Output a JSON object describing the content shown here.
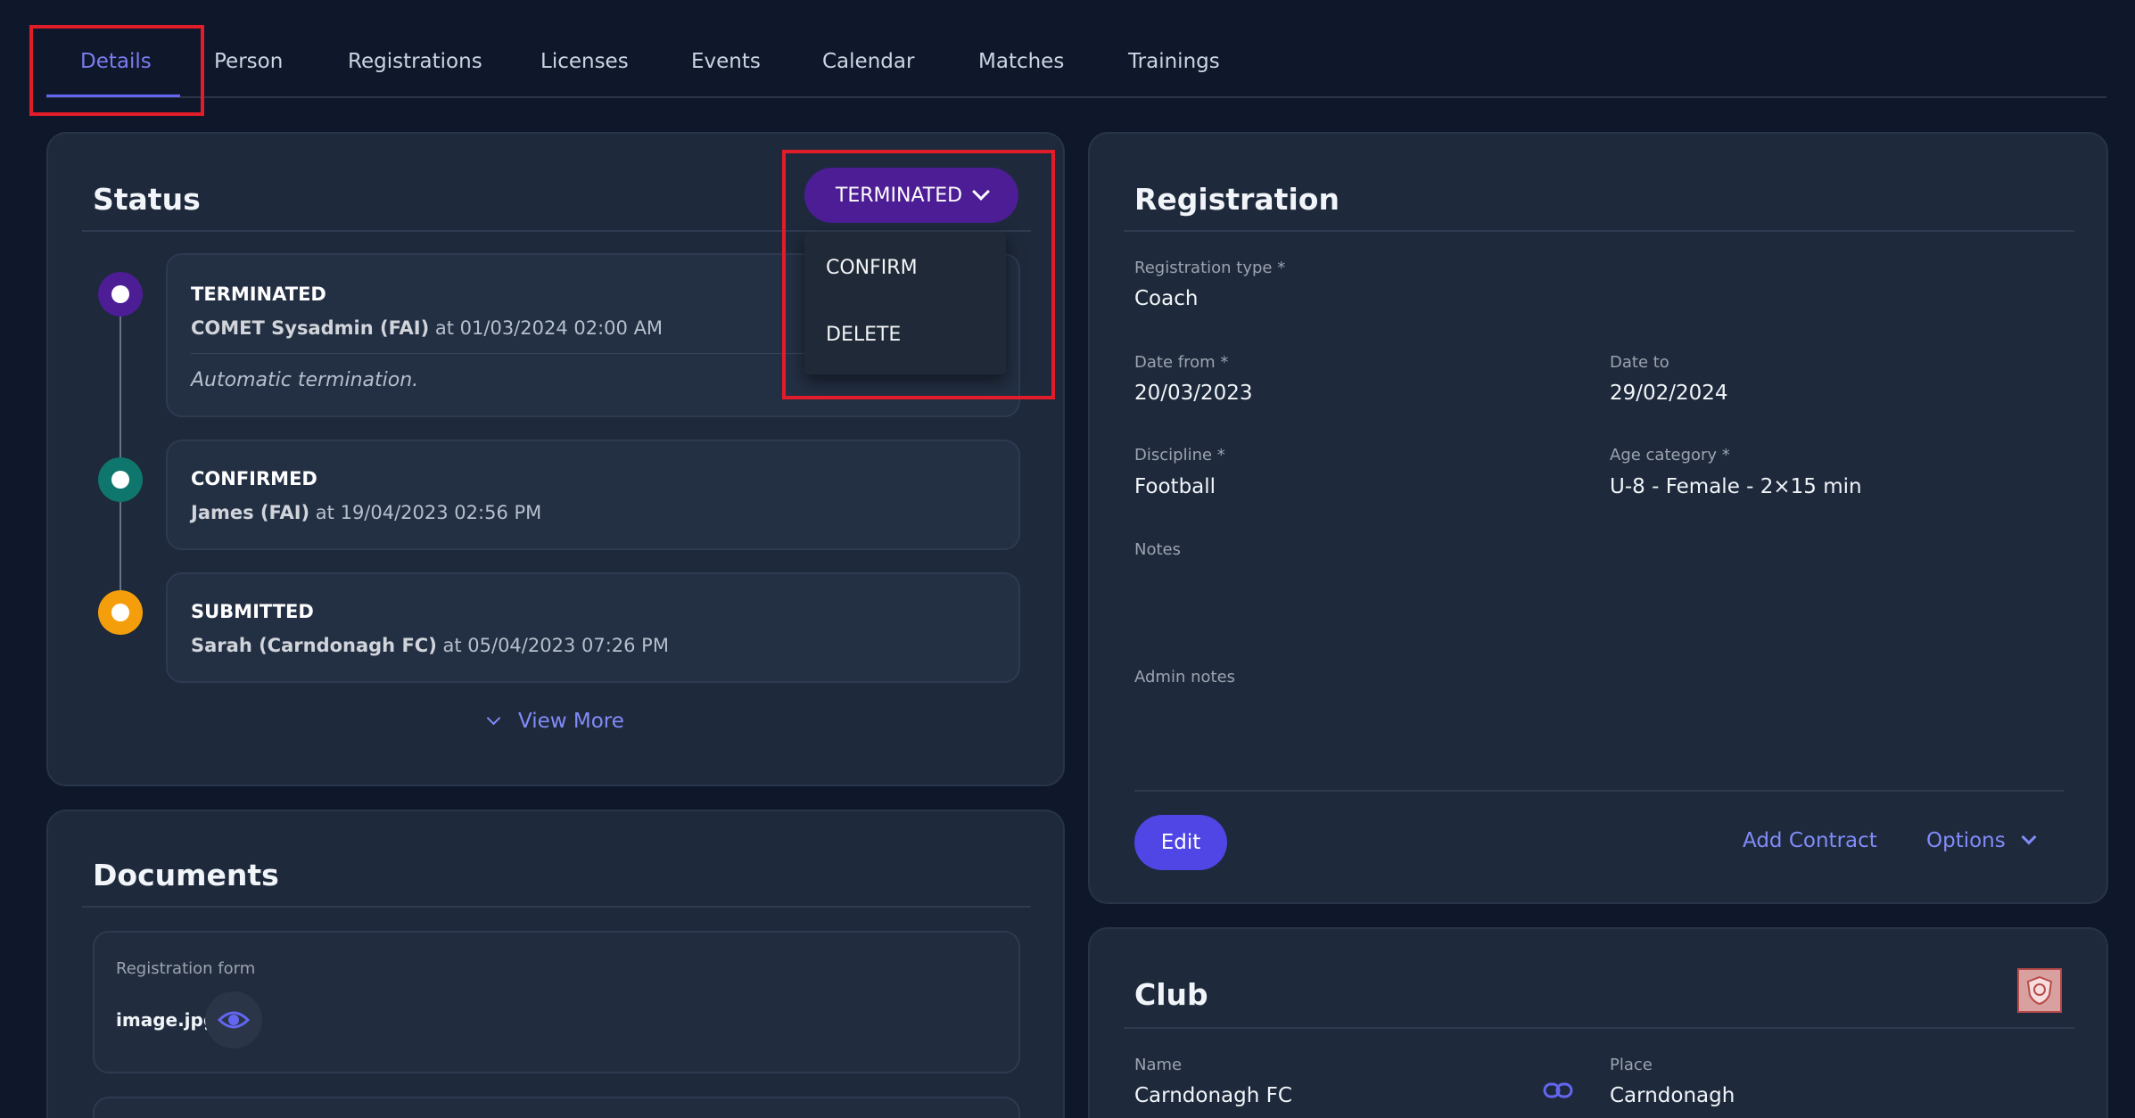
{
  "tabs": [
    {
      "label": "Details",
      "active": true
    },
    {
      "label": "Person"
    },
    {
      "label": "Registrations"
    },
    {
      "label": "Licenses"
    },
    {
      "label": "Events"
    },
    {
      "label": "Calendar"
    },
    {
      "label": "Matches"
    },
    {
      "label": "Trainings"
    }
  ],
  "status": {
    "title": "Status",
    "current": "TERMINATED",
    "dropdown": [
      "CONFIRM",
      "DELETE"
    ],
    "events": [
      {
        "title": "TERMINATED",
        "user": "COMET Sysadmin (FAI)",
        "at": " at 01/03/2024 02:00 AM",
        "note": "Automatic termination.",
        "color": "#4c1d95"
      },
      {
        "title": "CONFIRMED",
        "user": "James (FAI)",
        "at": " at 19/04/2023 02:56 PM",
        "color": "#0f766e"
      },
      {
        "title": "SUBMITTED",
        "user": "Sarah (Carndonagh FC)",
        "at": " at 05/04/2023 07:26 PM",
        "color": "#f59e0b"
      }
    ],
    "view_more": "View More"
  },
  "documents": {
    "title": "Documents",
    "label": "Registration form",
    "file": "image.jpg"
  },
  "registration": {
    "title": "Registration",
    "type_label": "Registration type *",
    "type_value": "Coach",
    "date_from_label": "Date from *",
    "date_from_value": "20/03/2023",
    "date_to_label": "Date to",
    "date_to_value": "29/02/2024",
    "discipline_label": "Discipline *",
    "discipline_value": "Football",
    "age_label": "Age category *",
    "age_value": "U-8 - Female - 2×15 min",
    "notes_label": "Notes",
    "admin_notes_label": "Admin notes",
    "edit": "Edit",
    "add_contract": "Add Contract",
    "options": "Options"
  },
  "club": {
    "title": "Club",
    "name_label": "Name",
    "name_value": "Carndonagh FC",
    "place_label": "Place",
    "place_value": "Carndonagh"
  },
  "colors": {
    "accent": "#6366f1",
    "terminated": "#4c1d95",
    "highlight": "#e11d2a"
  }
}
